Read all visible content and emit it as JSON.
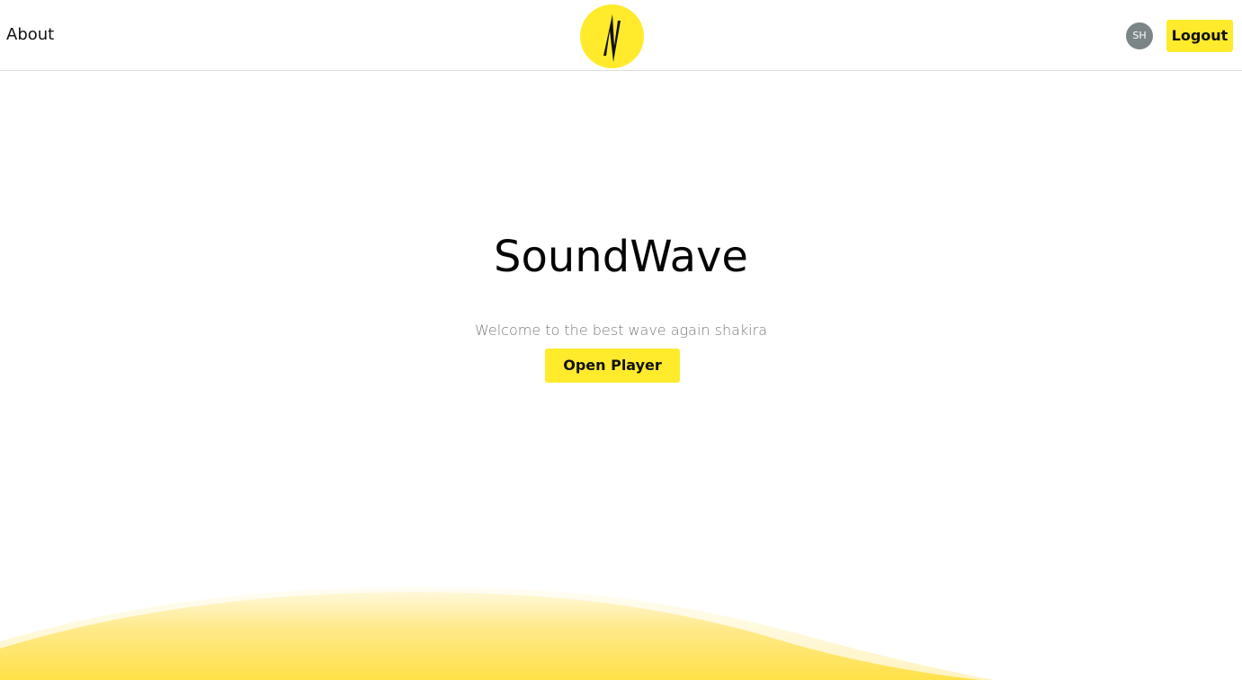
{
  "header": {
    "about_label": "About",
    "logo_icon": "lightning-bolt-logo-icon",
    "avatar_initials": "SH",
    "logout_label": "Logout"
  },
  "hero": {
    "title": "SoundWave",
    "subtitle": "Welcome to the best wave again shakira",
    "cta_label": "Open Player"
  },
  "colors": {
    "accent": "#ffea2c",
    "avatar_bg": "#7b8587",
    "subtitle": "#7a7a7a",
    "text": "#111111"
  }
}
